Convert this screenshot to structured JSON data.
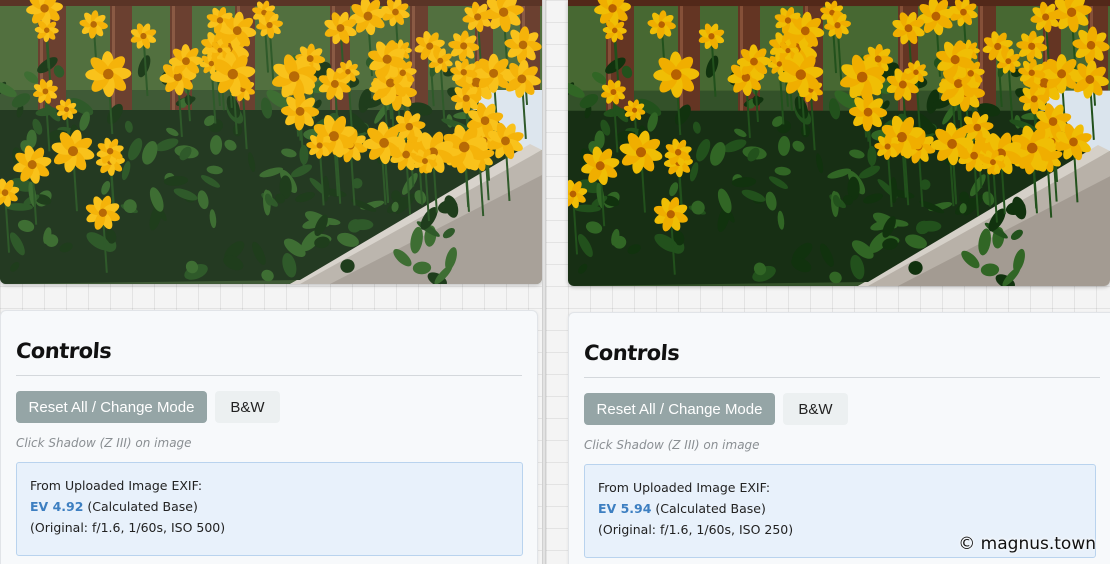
{
  "panes": [
    {
      "controls_title": "Controls",
      "reset_label": "Reset All / Change Mode",
      "bw_label": "B&W",
      "hint": "Click Shadow (Z III) on image",
      "exif_header": "From Uploaded Image EXIF:",
      "ev_value": "EV 4.92",
      "ev_suffix": "(Calculated Base)",
      "original": "(Original: f/1.6, 1/60s, ISO 500)"
    },
    {
      "controls_title": "Controls",
      "reset_label": "Reset All / Change Mode",
      "bw_label": "B&W",
      "hint": "Click Shadow (Z III) on image",
      "exif_header": "From Uploaded Image EXIF:",
      "ev_value": "EV 5.94",
      "ev_suffix": "(Calculated Base)",
      "original": "(Original: f/1.6, 1/60s, ISO 250)"
    }
  ],
  "watermark": "© magnus.town",
  "colors": {
    "reset_button": "#95a5a6",
    "bw_button": "#ecf0f1",
    "ev_accent": "#3d7fc1",
    "info_background": "#e8f1fb"
  }
}
